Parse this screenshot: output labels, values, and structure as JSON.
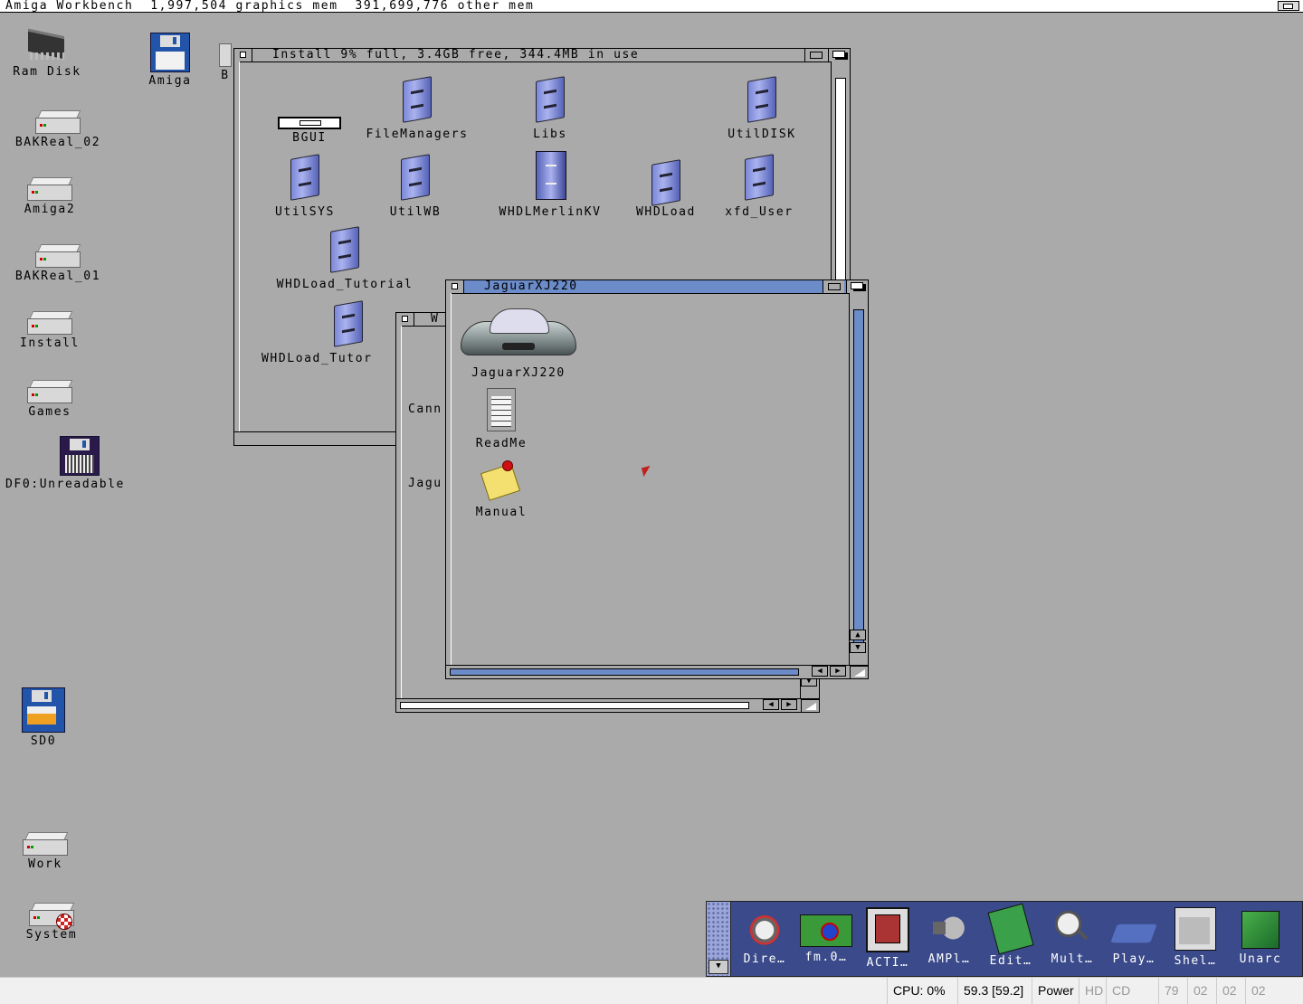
{
  "screen": {
    "title": "Amiga Workbench  1,997,504 graphics mem  391,699,776 other mem"
  },
  "desktop_icons": [
    {
      "label": "Ram Disk",
      "icon": "ram-chip-icon"
    },
    {
      "label": "Amiga",
      "icon": "floppy-icon"
    },
    {
      "label": "B",
      "icon": "hard-disk-icon"
    },
    {
      "label": "BAKReal_02",
      "icon": "hard-disk-icon"
    },
    {
      "label": "Amiga2",
      "icon": "hard-disk-icon"
    },
    {
      "label": "BAKReal_01",
      "icon": "hard-disk-icon"
    },
    {
      "label": "Install",
      "icon": "hard-disk-icon"
    },
    {
      "label": "Games",
      "icon": "hard-disk-icon"
    },
    {
      "label": "DF0:Unreadable",
      "icon": "bad-floppy-icon"
    },
    {
      "label": "SD0",
      "icon": "floppy-icon"
    },
    {
      "label": "Work",
      "icon": "hard-disk-icon"
    },
    {
      "label": "System",
      "icon": "system-disk-icon"
    }
  ],
  "install_window": {
    "title": "Install  9% full, 3.4GB free, 344.4MB  in  use",
    "icons": [
      "BGUI",
      "FileManagers",
      "Libs",
      "UtilDISK",
      "UtilSYS",
      "UtilWB",
      "WHDLMerlinKV",
      "WHDLoad",
      "xfd_User",
      "WHDLoad_Tutorial",
      "WHDLoad_Tutor"
    ]
  },
  "middle_window": {
    "title": "W",
    "texts": [
      "Cann",
      "Jagu"
    ]
  },
  "jaguar_window": {
    "title": "JaguarXJ220",
    "icons": [
      "JaguarXJ220",
      "ReadMe",
      "Manual"
    ]
  },
  "dock": {
    "items": [
      {
        "label": "Dire…",
        "icon": "directory-opus-icon"
      },
      {
        "label": "fm.0…",
        "icon": "file-manager-icon"
      },
      {
        "label": "ACTI…",
        "icon": "film-icon"
      },
      {
        "label": "AMPl…",
        "icon": "speaker-icon"
      },
      {
        "label": "Edit…",
        "icon": "notepad-icon"
      },
      {
        "label": "Mult…",
        "icon": "magnifier-icon"
      },
      {
        "label": "Play…",
        "icon": "player-icon"
      },
      {
        "label": "Shel…",
        "icon": "shell-icon"
      },
      {
        "label": "Unarc",
        "icon": "archive-box-icon"
      }
    ]
  },
  "statusbar": {
    "cpu": "CPU: 0%",
    "fps": "59.3 [59.2]",
    "power": "Power",
    "hd": "HD",
    "cd": "CD",
    "counters": [
      "79",
      "02",
      "02",
      "02"
    ]
  }
}
